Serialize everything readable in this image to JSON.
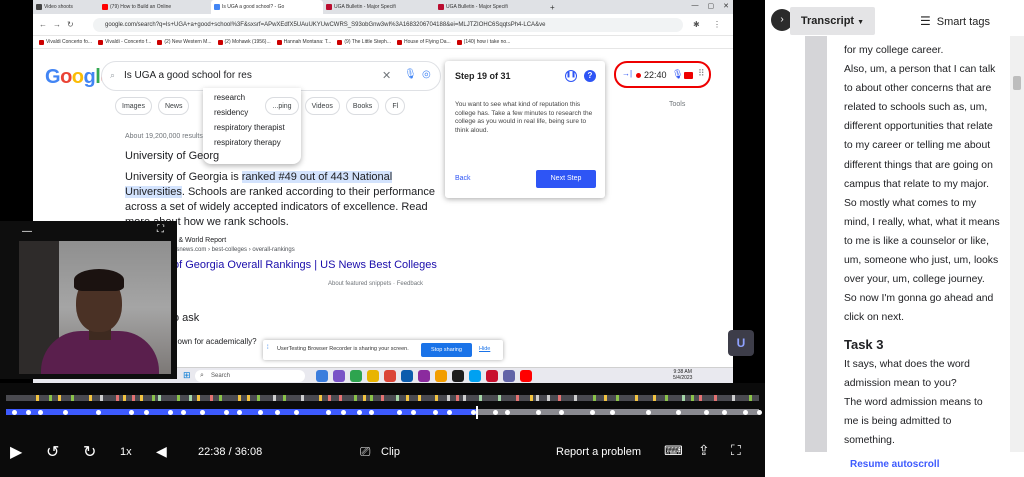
{
  "browser": {
    "tabs": [
      {
        "label": "Video shoots",
        "color": "#444444"
      },
      {
        "label": "(79) How to Build an Online",
        "color": "#ff0000"
      },
      {
        "label": "Is UGA a good school? - Go",
        "color": "#4285f4",
        "active": true
      },
      {
        "label": "UGA Bulletin - Major Specifi",
        "color": "#ba0c2f"
      },
      {
        "label": "UGA Bulletin - Major Specifi",
        "color": "#ba0c2f"
      }
    ],
    "url": "google.com/search?q=Is+UGA+a+good+school%3F&sxsrf=APwXEdfX5UAuUKYUwCWRS_S93obGnw3wI%3A1683206704188&ei=MLJTZIOHC6SqqtsPh4-LCA&ve",
    "bookmarks": [
      "Vivaldi Concerto fo...",
      "Vivaldi - Concerto f...",
      "(2) New Western M...",
      "(2) Mohawk (1956)...",
      "Hannah Montana: T...",
      "(9) The Little Steph...",
      "House of Flying Da...",
      "(140) how i take no..."
    ]
  },
  "google": {
    "logo": "Google",
    "query": "Is UGA a good school for res",
    "suggestions": [
      "research",
      "residency",
      "respiratory therapist",
      "respiratory therapy"
    ],
    "chips": [
      "Images",
      "News",
      "...ping",
      "Videos",
      "Books",
      "Fl"
    ],
    "tools": "Tools",
    "results_count": "About 19,200,000 results",
    "snippet_title": "University of Georg",
    "snippet_pre": "University of Georgia is ",
    "snippet_highlight": "ranked #49 out of 443 National Universities",
    "snippet_post": ". Schools are ranked according to their performance across a set of widely accepted indicators of excellence. Read more about how we rank schools.",
    "source_line": "s & World Report",
    "source_url": "usnews.com › best-colleges › overall-rankings",
    "result_title": "of Georgia Overall Rankings | US News Best Colleges",
    "featured": "About featured snippets  ·  Feedback",
    "people_ask": "o ask",
    "question": "nown for academically?"
  },
  "step": {
    "title": "Step 19 of 31",
    "body": "You want to see what kind of reputation this college has. Take a few minutes to research the college as you would in real life, being sure to think aloud.",
    "back": "Back",
    "next": "Next Step"
  },
  "recorder": {
    "time": "22:40"
  },
  "sharing": {
    "text": "UserTesting Browser Recorder is sharing your screen.",
    "stop": "Stop sharing",
    "hide": "Hide"
  },
  "taskbar": {
    "search": "Search",
    "time": "9:38 AM",
    "date": "5/4/2023"
  },
  "player": {
    "time": "22:38 / 36:08",
    "speed": "1x",
    "clip": "Clip",
    "report": "Report a problem",
    "progress": 0.626
  },
  "panel": {
    "transcript_label": "Transcript",
    "smart_tags_label": "Smart tags",
    "lines": [
      "for my college career.",
      "Also, um, a person that I can talk",
      "to about other concerns that are",
      "related to schools such as, um,",
      "different opportunities that relate",
      "to my career or telling me about",
      "different things that are going on",
      "campus that relate to my major.",
      "So mostly what comes to my",
      "mind, I really, what, what it means",
      "to me is like a counselor or like,",
      "um, someone who just, um, looks",
      "over your, um, college journey.",
      "So now I'm gonna go ahead and",
      "click on next."
    ],
    "task": "Task 3",
    "task_lines": [
      "It says, what does the word",
      "admission mean to you?",
      "The word admission means to",
      "me is being admitted to",
      "something."
    ],
    "resume": "Resume autoscroll"
  }
}
